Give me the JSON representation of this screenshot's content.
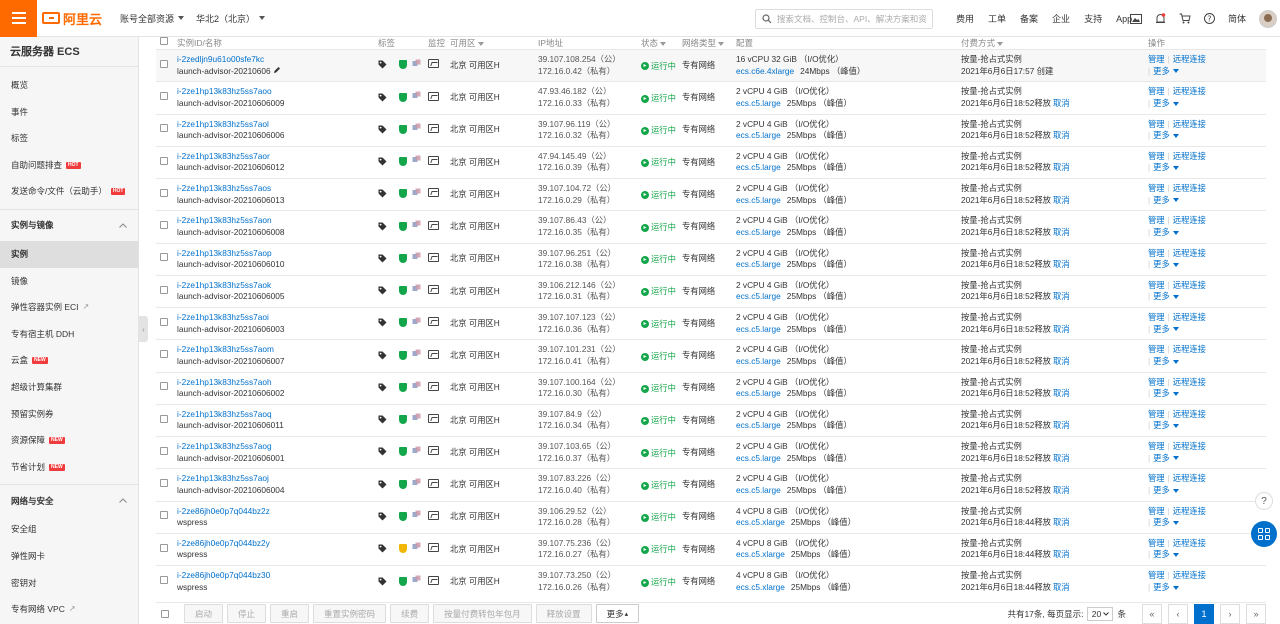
{
  "header": {
    "brand": "阿里云",
    "account_selector": "账号全部资源",
    "region_selector": "华北2（北京）",
    "search_placeholder": "搜索文档、控制台、API、解决方案和资源",
    "nav": [
      "费用",
      "工单",
      "备案",
      "企业",
      "支持",
      "App"
    ],
    "lang": "简体"
  },
  "sidebar": {
    "title": "云服务器 ECS",
    "items_top": [
      {
        "label": "概览"
      },
      {
        "label": "事件"
      },
      {
        "label": "标签"
      },
      {
        "label": "自助问题排查",
        "badge": "HOT"
      },
      {
        "label": "发送命令/文件（云助手）",
        "badge": "HOT"
      }
    ],
    "group1": "实例与镜像",
    "items_group1": [
      {
        "label": "实例"
      },
      {
        "label": "镜像"
      },
      {
        "label": "弹性容器实例 ECI"
      },
      {
        "label": "专有宿主机 DDH"
      },
      {
        "label": "云盒",
        "badge": "NEW"
      },
      {
        "label": "超级计算集群"
      },
      {
        "label": "预留实例券"
      },
      {
        "label": "资源保障",
        "badge": "NEW"
      },
      {
        "label": "节省计划",
        "badge": "NEW"
      }
    ],
    "group2": "网络与安全",
    "items_group2": [
      {
        "label": "安全组"
      },
      {
        "label": "弹性网卡"
      },
      {
        "label": "密钥对"
      },
      {
        "label": "专有网络 VPC"
      }
    ]
  },
  "table": {
    "headers": {
      "id": "实例ID/名称",
      "tag": "标签",
      "monitor": "监控",
      "zone": "可用区",
      "ip": "IP地址",
      "status": "状态",
      "network": "网络类型",
      "config": "配置",
      "billing": "付费方式",
      "ops": "操作"
    },
    "op_manage": "管理",
    "op_remote": "远程连接",
    "op_more": "更多",
    "cancel_label": "取消",
    "rows": [
      {
        "id": "i-2zedljn9u61o00sfe7kc",
        "name": "launch-advisor-20210606",
        "zone": "北京 可用区H",
        "pub_ip": "39.107.108.254（公）",
        "priv_ip": "172.16.0.42（私有）",
        "status": "运行中",
        "network": "专有网络",
        "cfg1": "16 vCPU 32 GiB （I/O优化）",
        "type": "ecs.c6e.4xlarge",
        "bw": "24Mbps （峰值）",
        "bill1": "按量-抢占式实例",
        "bill2": "2021年6月6日17:57 创建",
        "has_cancel": false,
        "shield": "green"
      },
      {
        "id": "i-2ze1hp13k83hz5ss7aoo",
        "name": "launch-advisor-20210606009",
        "zone": "北京 可用区H",
        "pub_ip": "47.93.46.182（公）",
        "priv_ip": "172.16.0.33（私有）",
        "status": "运行中",
        "network": "专有网络",
        "cfg1": "2 vCPU 4 GiB （I/O优化）",
        "type": "ecs.c5.large",
        "bw": "25Mbps （峰值）",
        "bill1": "按量-抢占式实例",
        "bill2": "2021年6月6日18:52释放",
        "has_cancel": true,
        "shield": "green"
      },
      {
        "id": "i-2ze1hp13k83hz5ss7aol",
        "name": "launch-advisor-20210606006",
        "zone": "北京 可用区H",
        "pub_ip": "39.107.96.119（公）",
        "priv_ip": "172.16.0.32（私有）",
        "status": "运行中",
        "network": "专有网络",
        "cfg1": "2 vCPU 4 GiB （I/O优化）",
        "type": "ecs.c5.large",
        "bw": "25Mbps （峰值）",
        "bill1": "按量-抢占式实例",
        "bill2": "2021年6月6日18:52释放",
        "has_cancel": true,
        "shield": "green"
      },
      {
        "id": "i-2ze1hp13k83hz5ss7aor",
        "name": "launch-advisor-20210606012",
        "zone": "北京 可用区H",
        "pub_ip": "47.94.145.49（公）",
        "priv_ip": "172.16.0.39（私有）",
        "status": "运行中",
        "network": "专有网络",
        "cfg1": "2 vCPU 4 GiB （I/O优化）",
        "type": "ecs.c5.large",
        "bw": "25Mbps （峰值）",
        "bill1": "按量-抢占式实例",
        "bill2": "2021年6月6日18:52释放",
        "has_cancel": true,
        "shield": "green"
      },
      {
        "id": "i-2ze1hp13k83hz5ss7aos",
        "name": "launch-advisor-20210606013",
        "zone": "北京 可用区H",
        "pub_ip": "39.107.104.72（公）",
        "priv_ip": "172.16.0.29（私有）",
        "status": "运行中",
        "network": "专有网络",
        "cfg1": "2 vCPU 4 GiB （I/O优化）",
        "type": "ecs.c5.large",
        "bw": "25Mbps （峰值）",
        "bill1": "按量-抢占式实例",
        "bill2": "2021年6月6日18:52释放",
        "has_cancel": true,
        "shield": "green"
      },
      {
        "id": "i-2ze1hp13k83hz5ss7aon",
        "name": "launch-advisor-20210606008",
        "zone": "北京 可用区H",
        "pub_ip": "39.107.86.43（公）",
        "priv_ip": "172.16.0.35（私有）",
        "status": "运行中",
        "network": "专有网络",
        "cfg1": "2 vCPU 4 GiB （I/O优化）",
        "type": "ecs.c5.large",
        "bw": "25Mbps （峰值）",
        "bill1": "按量-抢占式实例",
        "bill2": "2021年6月6日18:52释放",
        "has_cancel": true,
        "shield": "green"
      },
      {
        "id": "i-2ze1hp13k83hz5ss7aop",
        "name": "launch-advisor-20210606010",
        "zone": "北京 可用区H",
        "pub_ip": "39.107.96.251（公）",
        "priv_ip": "172.16.0.38（私有）",
        "status": "运行中",
        "network": "专有网络",
        "cfg1": "2 vCPU 4 GiB （I/O优化）",
        "type": "ecs.c5.large",
        "bw": "25Mbps （峰值）",
        "bill1": "按量-抢占式实例",
        "bill2": "2021年6月6日18:52释放",
        "has_cancel": true,
        "shield": "green"
      },
      {
        "id": "i-2ze1hp13k83hz5ss7aok",
        "name": "launch-advisor-20210606005",
        "zone": "北京 可用区H",
        "pub_ip": "39.106.212.146（公）",
        "priv_ip": "172.16.0.31（私有）",
        "status": "运行中",
        "network": "专有网络",
        "cfg1": "2 vCPU 4 GiB （I/O优化）",
        "type": "ecs.c5.large",
        "bw": "25Mbps （峰值）",
        "bill1": "按量-抢占式实例",
        "bill2": "2021年6月6日18:52释放",
        "has_cancel": true,
        "shield": "green"
      },
      {
        "id": "i-2ze1hp13k83hz5ss7aoi",
        "name": "launch-advisor-20210606003",
        "zone": "北京 可用区H",
        "pub_ip": "39.107.107.123（公）",
        "priv_ip": "172.16.0.36（私有）",
        "status": "运行中",
        "network": "专有网络",
        "cfg1": "2 vCPU 4 GiB （I/O优化）",
        "type": "ecs.c5.large",
        "bw": "25Mbps （峰值）",
        "bill1": "按量-抢占式实例",
        "bill2": "2021年6月6日18:52释放",
        "has_cancel": true,
        "shield": "green"
      },
      {
        "id": "i-2ze1hp13k83hz5ss7aom",
        "name": "launch-advisor-20210606007",
        "zone": "北京 可用区H",
        "pub_ip": "39.107.101.231（公）",
        "priv_ip": "172.16.0.41（私有）",
        "status": "运行中",
        "network": "专有网络",
        "cfg1": "2 vCPU 4 GiB （I/O优化）",
        "type": "ecs.c5.large",
        "bw": "25Mbps （峰值）",
        "bill1": "按量-抢占式实例",
        "bill2": "2021年6月6日18:52释放",
        "has_cancel": true,
        "shield": "green"
      },
      {
        "id": "i-2ze1hp13k83hz5ss7aoh",
        "name": "launch-advisor-20210606002",
        "zone": "北京 可用区H",
        "pub_ip": "39.107.100.164（公）",
        "priv_ip": "172.16.0.30（私有）",
        "status": "运行中",
        "network": "专有网络",
        "cfg1": "2 vCPU 4 GiB （I/O优化）",
        "type": "ecs.c5.large",
        "bw": "25Mbps （峰值）",
        "bill1": "按量-抢占式实例",
        "bill2": "2021年6月6日18:52释放",
        "has_cancel": true,
        "shield": "green"
      },
      {
        "id": "i-2ze1hp13k83hz5ss7aoq",
        "name": "launch-advisor-20210606011",
        "zone": "北京 可用区H",
        "pub_ip": "39.107.84.9（公）",
        "priv_ip": "172.16.0.34（私有）",
        "status": "运行中",
        "network": "专有网络",
        "cfg1": "2 vCPU 4 GiB （I/O优化）",
        "type": "ecs.c5.large",
        "bw": "25Mbps （峰值）",
        "bill1": "按量-抢占式实例",
        "bill2": "2021年6月6日18:52释放",
        "has_cancel": true,
        "shield": "green"
      },
      {
        "id": "i-2ze1hp13k83hz5ss7aog",
        "name": "launch-advisor-20210606001",
        "zone": "北京 可用区H",
        "pub_ip": "39.107.103.65（公）",
        "priv_ip": "172.16.0.37（私有）",
        "status": "运行中",
        "network": "专有网络",
        "cfg1": "2 vCPU 4 GiB （I/O优化）",
        "type": "ecs.c5.large",
        "bw": "25Mbps （峰值）",
        "bill1": "按量-抢占式实例",
        "bill2": "2021年6月6日18:52释放",
        "has_cancel": true,
        "shield": "green"
      },
      {
        "id": "i-2ze1hp13k83hz5ss7aoj",
        "name": "launch-advisor-20210606004",
        "zone": "北京 可用区H",
        "pub_ip": "39.107.83.226（公）",
        "priv_ip": "172.16.0.40（私有）",
        "status": "运行中",
        "network": "专有网络",
        "cfg1": "2 vCPU 4 GiB （I/O优化）",
        "type": "ecs.c5.large",
        "bw": "25Mbps （峰值）",
        "bill1": "按量-抢占式实例",
        "bill2": "2021年6月6日18:52释放",
        "has_cancel": true,
        "shield": "green"
      },
      {
        "id": "i-2ze86jh0e0p7q044bz2z",
        "name": "wspress",
        "zone": "北京 可用区H",
        "pub_ip": "39.106.29.52（公）",
        "priv_ip": "172.16.0.28（私有）",
        "status": "运行中",
        "network": "专有网络",
        "cfg1": "4 vCPU 8 GiB （I/O优化）",
        "type": "ecs.c5.xlarge",
        "bw": "25Mbps （峰值）",
        "bill1": "按量-抢占式实例",
        "bill2": "2021年6月6日18:44释放",
        "has_cancel": true,
        "shield": "green"
      },
      {
        "id": "i-2ze86jh0e0p7q044bz2y",
        "name": "wspress",
        "zone": "北京 可用区H",
        "pub_ip": "39.107.75.236（公）",
        "priv_ip": "172.16.0.27（私有）",
        "status": "运行中",
        "network": "专有网络",
        "cfg1": "4 vCPU 8 GiB （I/O优化）",
        "type": "ecs.c5.xlarge",
        "bw": "25Mbps （峰值）",
        "bill1": "按量-抢占式实例",
        "bill2": "2021年6月6日18:44释放",
        "has_cancel": true,
        "shield": "yellow"
      },
      {
        "id": "i-2ze86jh0e0p7q044bz30",
        "name": "wspress",
        "zone": "北京 可用区H",
        "pub_ip": "39.107.73.250（公）",
        "priv_ip": "172.16.0.26（私有）",
        "status": "运行中",
        "network": "专有网络",
        "cfg1": "4 vCPU 8 GiB （I/O优化）",
        "type": "ecs.c5.xlarge",
        "bw": "25Mbps （峰值）",
        "bill1": "按量-抢占式实例",
        "bill2": "2021年6月6日18:44释放",
        "has_cancel": true,
        "shield": "green"
      }
    ]
  },
  "footer": {
    "buttons": [
      "启动",
      "停止",
      "重启",
      "重置实例密码",
      "续费",
      "按量付费转包年包月",
      "释放设置",
      "更多"
    ],
    "total_text": "共有17条, 每页显示:",
    "page_size": "20",
    "unit": "条",
    "current_page": "1"
  },
  "colors": {
    "brand": "#ff6a00",
    "link": "#0070cc",
    "running": "#14a64b"
  }
}
